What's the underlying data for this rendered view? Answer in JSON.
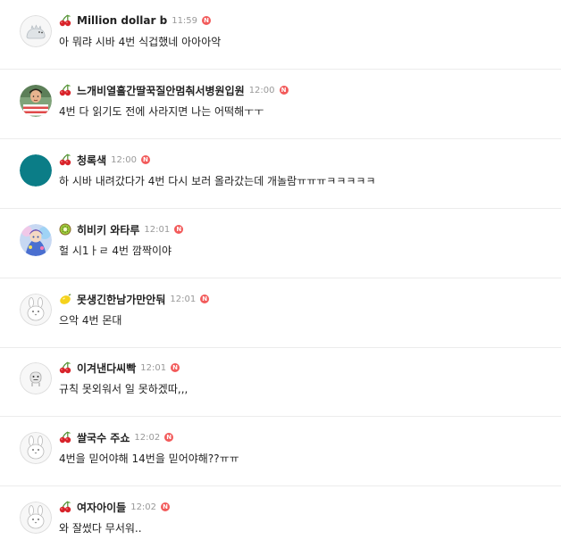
{
  "comments": [
    {
      "emoji": "cherry-icon",
      "nickname": "Million dollar b",
      "time": "11:59",
      "new_badge": "N",
      "text": "아 뭐랴 시바 4번 식겁했네 아아아악"
    },
    {
      "emoji": "cherry-icon",
      "nickname": "느개비열흘간딸꾹질안멈춰서병원입원",
      "time": "12:00",
      "new_badge": "N",
      "text": "4번 다 읽기도 전에 사라지면 나는 어떡해ㅜㅜ"
    },
    {
      "emoji": "cherry-icon",
      "nickname": "청록색",
      "time": "12:00",
      "new_badge": "N",
      "text": "하 시바 내려갔다가 4번 다시 보러 올라갔는데 개놀람ㅠㅠㅠㅋㅋㅋㅋㅋ"
    },
    {
      "emoji": "kiwi-icon",
      "nickname": "히비키 와타루",
      "time": "12:01",
      "new_badge": "N",
      "text": "헐 시1ㅏㄹ 4번 깜짝이야"
    },
    {
      "emoji": "lemon-icon",
      "nickname": "못생긴한남가만안둬",
      "time": "12:01",
      "new_badge": "N",
      "text": "으악 4번 몬대"
    },
    {
      "emoji": "cherry-icon",
      "nickname": "이겨낸다씨빡",
      "time": "12:01",
      "new_badge": "N",
      "text": "규칙 못외워서 일 못하겠따,,,"
    },
    {
      "emoji": "cherry-icon",
      "nickname": "쌀국수 주쇼",
      "time": "12:02",
      "new_badge": "N",
      "text": "4번을 믿어야해 14번을 믿어야해??ㅠㅠ"
    },
    {
      "emoji": "cherry-icon",
      "nickname": "여자아이들",
      "time": "12:02",
      "new_badge": "N",
      "text": "와 잘썼다 무서워.."
    }
  ],
  "colors": {
    "new_badge": "#f25a5a",
    "teal_avatar": "#0b7d87",
    "divider": "#ececec",
    "time": "#999999"
  }
}
